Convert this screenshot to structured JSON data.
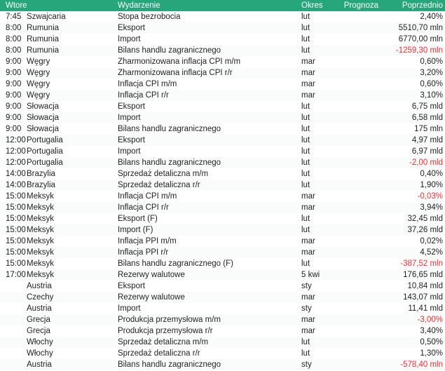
{
  "table": {
    "headers": {
      "time": "Wtorek",
      "country": "",
      "event": "Wydarzenie",
      "period": "Okres",
      "forecast": "Prognoza",
      "previous": "Poprzednio"
    },
    "colors": {
      "header_background": "#27a57b",
      "header_text": "#ffffff",
      "body_text": "#222222",
      "negative_value": "#ee2f33",
      "row_background": "#ffffff",
      "row_background_alt": "#fafcfb"
    },
    "rows": [
      {
        "time": "7:45",
        "country": "Szwajcaria",
        "event": "Stopa bezrobocia",
        "period": "lut",
        "forecast": "",
        "previous": "2,40%",
        "negative": false
      },
      {
        "time": "8:00",
        "country": "Rumunia",
        "event": "Eksport",
        "period": "lut",
        "forecast": "",
        "previous": "5510,70 mln",
        "negative": false
      },
      {
        "time": "8:00",
        "country": "Rumunia",
        "event": "Import",
        "period": "lut",
        "forecast": "",
        "previous": "6770,00 mln",
        "negative": false
      },
      {
        "time": "8:00",
        "country": "Rumunia",
        "event": "Bilans handlu zagranicznego",
        "period": "lut",
        "forecast": "",
        "previous": "-1259,30 mln",
        "negative": true
      },
      {
        "time": "9:00",
        "country": "Węgry",
        "event": "Zharmonizowana inflacja CPI m/m",
        "period": "mar",
        "forecast": "",
        "previous": "0,60%",
        "negative": false
      },
      {
        "time": "9:00",
        "country": "Węgry",
        "event": "Zharmonizowana inflacja CPI r/r",
        "period": "mar",
        "forecast": "",
        "previous": "3,20%",
        "negative": false
      },
      {
        "time": "9:00",
        "country": "Węgry",
        "event": "Inflacja CPI m/m",
        "period": "mar",
        "forecast": "",
        "previous": "0,60%",
        "negative": false
      },
      {
        "time": "9:00",
        "country": "Węgry",
        "event": "Inflacja CPI r/r",
        "period": "mar",
        "forecast": "",
        "previous": "3,10%",
        "negative": false
      },
      {
        "time": "9:00",
        "country": "Słowacja",
        "event": "Eksport",
        "period": "lut",
        "forecast": "",
        "previous": "6,75 mld",
        "negative": false
      },
      {
        "time": "9:00",
        "country": "Słowacja",
        "event": "Import",
        "period": "lut",
        "forecast": "",
        "previous": "6,58 mld",
        "negative": false
      },
      {
        "time": "9:00",
        "country": "Słowacja",
        "event": "Bilans handlu zagranicznego",
        "period": "lut",
        "forecast": "",
        "previous": "175 mln",
        "negative": false
      },
      {
        "time": "12:00",
        "country": "Portugalia",
        "event": "Eksport",
        "period": "lut",
        "forecast": "",
        "previous": "4,97 mld",
        "negative": false
      },
      {
        "time": "12:00",
        "country": "Portugalia",
        "event": "Import",
        "period": "lut",
        "forecast": "",
        "previous": "6,97 mld",
        "negative": false
      },
      {
        "time": "12:00",
        "country": "Portugalia",
        "event": "Bilans handlu zagranicznego",
        "period": "lut",
        "forecast": "",
        "previous": "-2,00 mld",
        "negative": true
      },
      {
        "time": "14:00",
        "country": "Brazylia",
        "event": "Sprzedaż detaliczna m/m",
        "period": "lut",
        "forecast": "",
        "previous": "0,40%",
        "negative": false
      },
      {
        "time": "14:00",
        "country": "Brazylia",
        "event": "Sprzedaż detaliczna r/r",
        "period": "lut",
        "forecast": "",
        "previous": "1,90%",
        "negative": false
      },
      {
        "time": "15:00",
        "country": "Meksyk",
        "event": "Inflacja CPI m/m",
        "period": "mar",
        "forecast": "",
        "previous": "-0,03%",
        "negative": true
      },
      {
        "time": "15:00",
        "country": "Meksyk",
        "event": "Inflacja CPI r/r",
        "period": "mar",
        "forecast": "",
        "previous": "3,94%",
        "negative": false
      },
      {
        "time": "15:00",
        "country": "Meksyk",
        "event": "Eksport (F)",
        "period": "lut",
        "forecast": "",
        "previous": "32,45 mld",
        "negative": false
      },
      {
        "time": "15:00",
        "country": "Meksyk",
        "event": "Import (F)",
        "period": "lut",
        "forecast": "",
        "previous": "37,26 mld",
        "negative": false
      },
      {
        "time": "15:00",
        "country": "Meksyk",
        "event": "Inflacja PPI m/m",
        "period": "mar",
        "forecast": "",
        "previous": "0,02%",
        "negative": false
      },
      {
        "time": "15:00",
        "country": "Meksyk",
        "event": "Inflacja PPI r/r",
        "period": "mar",
        "forecast": "",
        "previous": "4,52%",
        "negative": false
      },
      {
        "time": "15:00",
        "country": "Meksyk",
        "event": "Bilans handlu zagranicznego (F)",
        "period": "lut",
        "forecast": "",
        "previous": "-387,52 mln",
        "negative": true
      },
      {
        "time": "17:00",
        "country": "Meksyk",
        "event": "Rezerwy walutowe",
        "period": "5 kwi",
        "forecast": "",
        "previous": "176,65 mld",
        "negative": false
      },
      {
        "time": "",
        "country": "Austria",
        "event": "Eksport",
        "period": "sty",
        "forecast": "",
        "previous": "10,84 mld",
        "negative": false
      },
      {
        "time": "",
        "country": "Czechy",
        "event": "Rezerwy walutowe",
        "period": "mar",
        "forecast": "",
        "previous": "143,07 mld",
        "negative": false
      },
      {
        "time": "",
        "country": "Austria",
        "event": "Import",
        "period": "sty",
        "forecast": "",
        "previous": "11,41 mld",
        "negative": false
      },
      {
        "time": "",
        "country": "Grecja",
        "event": "Produkcja przemysłowa m/m",
        "period": "mar",
        "forecast": "",
        "previous": "-3,00%",
        "negative": true
      },
      {
        "time": "",
        "country": "Grecja",
        "event": "Produkcja przemysłowa r/r",
        "period": "mar",
        "forecast": "",
        "previous": "3,40%",
        "negative": false
      },
      {
        "time": "",
        "country": "Włochy",
        "event": "Sprzedaż detaliczna m/m",
        "period": "lut",
        "forecast": "",
        "previous": "0,50%",
        "negative": false
      },
      {
        "time": "",
        "country": "Włochy",
        "event": "Sprzedaż detaliczna r/r",
        "period": "lut",
        "forecast": "",
        "previous": "1,30%",
        "negative": false
      },
      {
        "time": "",
        "country": "Austria",
        "event": "Bilans handlu zagranicznego",
        "period": "sty",
        "forecast": "",
        "previous": "-578,40 mln",
        "negative": true
      }
    ]
  }
}
